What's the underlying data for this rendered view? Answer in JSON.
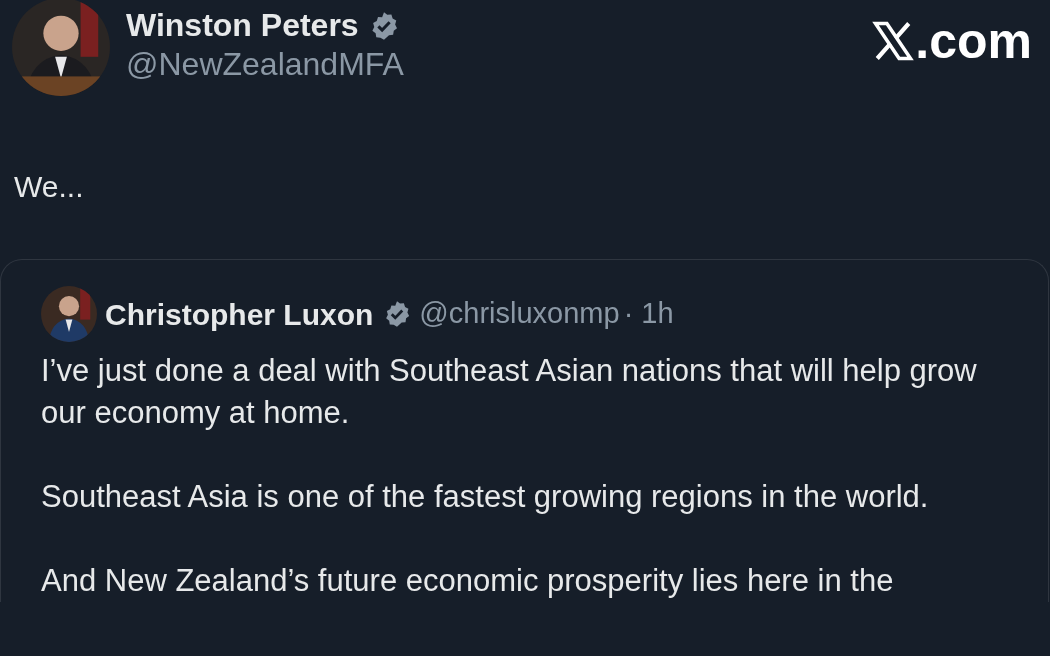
{
  "post": {
    "author": {
      "name": "Winston Peters",
      "verified": true,
      "handle": "@NewZealandMFA"
    },
    "watermark_site": ".com",
    "text": "We...",
    "quote": {
      "author": {
        "name": "Christopher Luxon",
        "verified": true,
        "handle": "@chrisluxonmp",
        "time": "· 1h"
      },
      "paragraphs": [
        "I’ve just done a deal with Southeast Asian nations that will help grow our economy at home.",
        "Southeast Asia is one of the fastest growing regions in the world.",
        "And New Zealand’s future economic prosperity lies here in the"
      ]
    }
  }
}
